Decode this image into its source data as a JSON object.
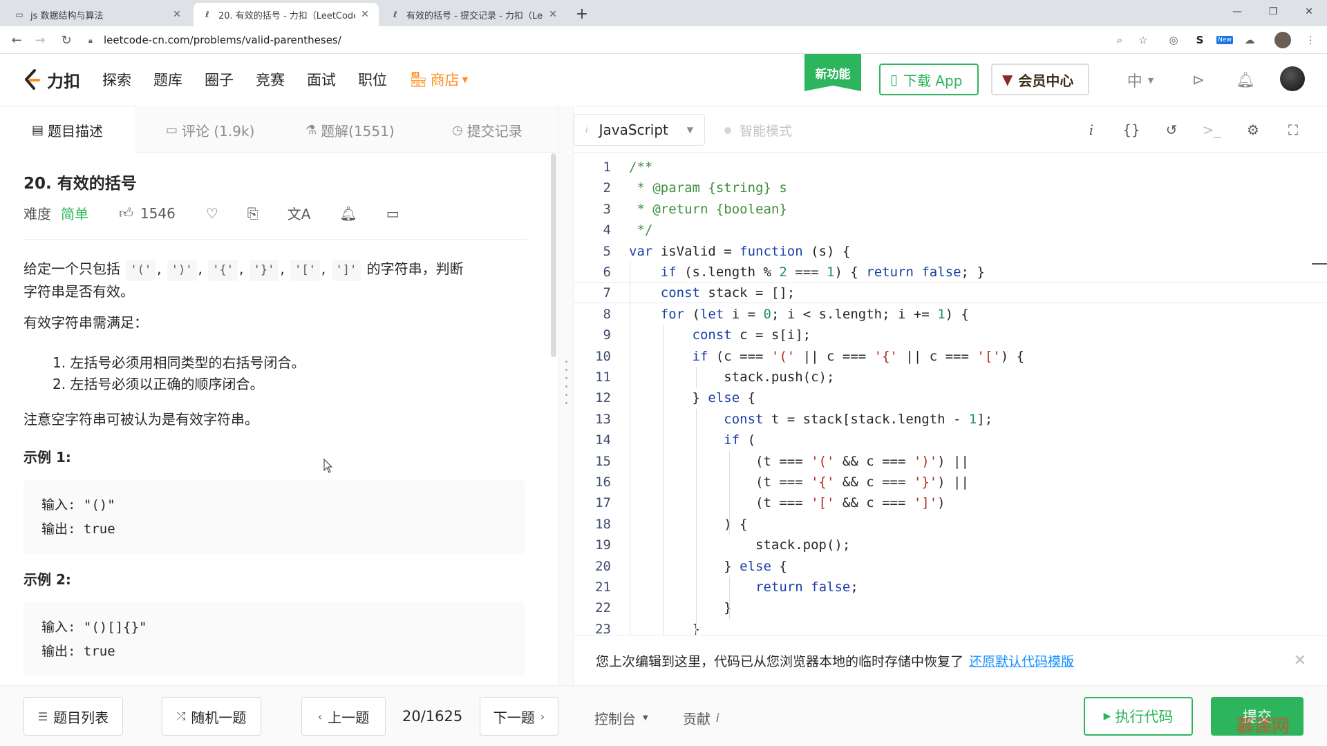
{
  "browser": {
    "tabs": [
      {
        "title": "js 数据结构与算法",
        "close": "✕"
      },
      {
        "title": "20. 有效的括号 - 力扣（LeetCode）",
        "close": "✕"
      },
      {
        "title": "有效的括号 - 提交记录 - 力扣（LeetCode）",
        "close": "✕"
      }
    ],
    "new_tab": "+",
    "url": "leetcode-cn.com/problems/valid-parentheses/",
    "ext_badge": "New"
  },
  "header": {
    "logo_text": "力扣",
    "nav": [
      "探索",
      "题库",
      "圈子",
      "竞赛",
      "面试",
      "职位"
    ],
    "shop": "商店",
    "new_feature": "新功能",
    "download_app": "下载 App",
    "vip_center": "会员中心",
    "lang": "中"
  },
  "left_tabs": {
    "description": "题目描述",
    "comments": "评论 (1.9k)",
    "solutions": "题解(1551)",
    "submissions": "提交记录"
  },
  "problem": {
    "title": "20. 有效的括号",
    "difficulty_label": "难度",
    "difficulty": "简单",
    "likes": "1546",
    "desc_prefix": "给定一个只包括",
    "chars": [
      "'('",
      "')'",
      "'{'",
      "'}'",
      "'['",
      "']'"
    ],
    "desc_suffix": "的字符串，判断",
    "desc_line2": "字符串是否有效。",
    "valid_header": "有效字符串需满足：",
    "rules": [
      "1. 左括号必须用相同类型的右括号闭合。",
      "2. 左括号必须以正确的顺序闭合。"
    ],
    "note": "注意空字符串可被认为是有效字符串。",
    "examples": [
      {
        "title": "示例 1:",
        "input": "输入: \"()\"",
        "output": "输出: true"
      },
      {
        "title": "示例 2:",
        "input": "输入: \"()[]{}\"",
        "output": "输出: true"
      }
    ]
  },
  "editor": {
    "language": "JavaScript",
    "smart_mode": "智能模式",
    "lines": [
      {
        "n": "1",
        "t": "/**",
        "c": "comment"
      },
      {
        "n": "2",
        "t": " * @param {string} s",
        "c": "comment"
      },
      {
        "n": "3",
        "t": " * @return {boolean}",
        "c": "comment"
      },
      {
        "n": "4",
        "t": " */",
        "c": "comment"
      },
      {
        "n": "5",
        "t": "var isValid = function (s) {",
        "c": "code"
      },
      {
        "n": "6",
        "t": "    if (s.length % 2 === 1) { return false; }",
        "c": "code"
      },
      {
        "n": "7",
        "t": "    const stack = [];",
        "c": "code"
      },
      {
        "n": "8",
        "t": "    for (let i = 0; i < s.length; i += 1) {",
        "c": "code"
      },
      {
        "n": "9",
        "t": "        const c = s[i];",
        "c": "code"
      },
      {
        "n": "10",
        "t": "        if (c === '(' || c === '{' || c === '[') {",
        "c": "code"
      },
      {
        "n": "11",
        "t": "            stack.push(c);",
        "c": "code"
      },
      {
        "n": "12",
        "t": "        } else {",
        "c": "code"
      },
      {
        "n": "13",
        "t": "            const t = stack[stack.length - 1];",
        "c": "code"
      },
      {
        "n": "14",
        "t": "            if (",
        "c": "code"
      },
      {
        "n": "15",
        "t": "                (t === '(' && c === ')') ||",
        "c": "code"
      },
      {
        "n": "16",
        "t": "                (t === '{' && c === '}') ||",
        "c": "code"
      },
      {
        "n": "17",
        "t": "                (t === '[' && c === ']')",
        "c": "code"
      },
      {
        "n": "18",
        "t": "            ) {",
        "c": "code"
      },
      {
        "n": "19",
        "t": "                stack.pop();",
        "c": "code"
      },
      {
        "n": "20",
        "t": "            } else {",
        "c": "code"
      },
      {
        "n": "21",
        "t": "                return false;",
        "c": "code"
      },
      {
        "n": "22",
        "t": "            }",
        "c": "code"
      },
      {
        "n": "23",
        "t": "        }",
        "c": "code"
      }
    ]
  },
  "notice": {
    "text": "您上次编辑到这里，代码已从您浏览器本地的临时存储中恢复了",
    "link": "还原默认代码模版",
    "close": "✕"
  },
  "footer": {
    "problem_list": "题目列表",
    "random": "随机一题",
    "prev": "上一题",
    "counter": "20/1625",
    "next": "下一题",
    "console": "控制台",
    "contribute": "贡献",
    "run": "执行代码",
    "submit": "提交",
    "watermark": "慕课网"
  }
}
